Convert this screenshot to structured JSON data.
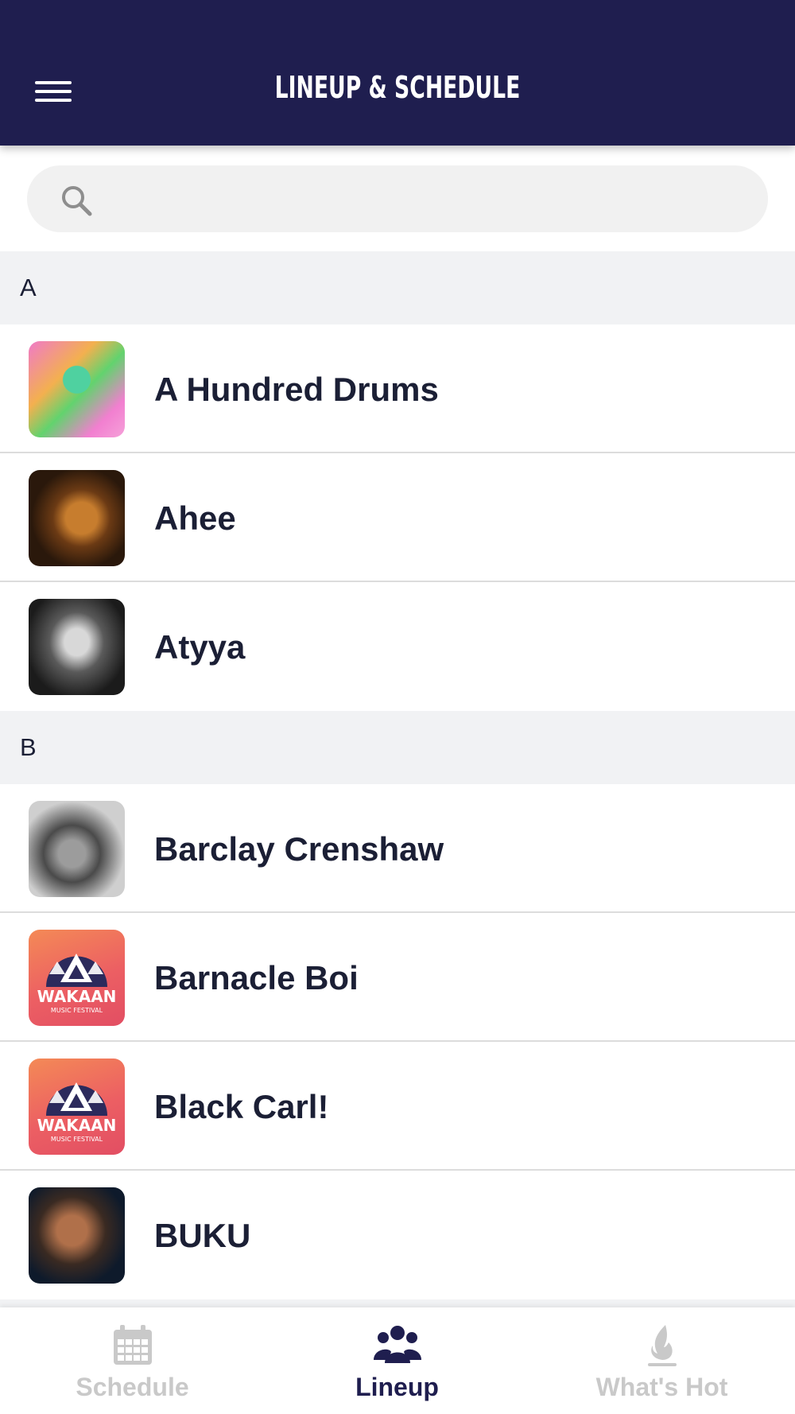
{
  "header": {
    "title": "LINEUP & SCHEDULE"
  },
  "search": {
    "placeholder": "",
    "value": ""
  },
  "sections": [
    {
      "letter": "A",
      "artists": [
        {
          "name": "A Hundred Drums",
          "thumb": "photo"
        },
        {
          "name": "Ahee",
          "thumb": "photo"
        },
        {
          "name": "Atyya",
          "thumb": "photo"
        }
      ]
    },
    {
      "letter": "B",
      "artists": [
        {
          "name": "Barclay Crenshaw",
          "thumb": "photo"
        },
        {
          "name": "Barnacle Boi",
          "thumb": "wakaan-logo"
        },
        {
          "name": "Black Carl!",
          "thumb": "wakaan-logo"
        },
        {
          "name": "BUKU",
          "thumb": "photo"
        }
      ]
    }
  ],
  "logo": {
    "brand": "WAKAAN",
    "sub": "MUSIC FESTIVAL"
  },
  "tabs": [
    {
      "label": "Schedule",
      "icon": "calendar-icon",
      "active": false
    },
    {
      "label": "Lineup",
      "icon": "people-icon",
      "active": true
    },
    {
      "label": "What's Hot",
      "icon": "flame-icon",
      "active": false
    }
  ],
  "colors": {
    "header_bg": "#1f1e4f",
    "active_tab": "#1f1e4f",
    "inactive_tab": "#c9c9c9",
    "section_bg": "#f1f2f4"
  }
}
